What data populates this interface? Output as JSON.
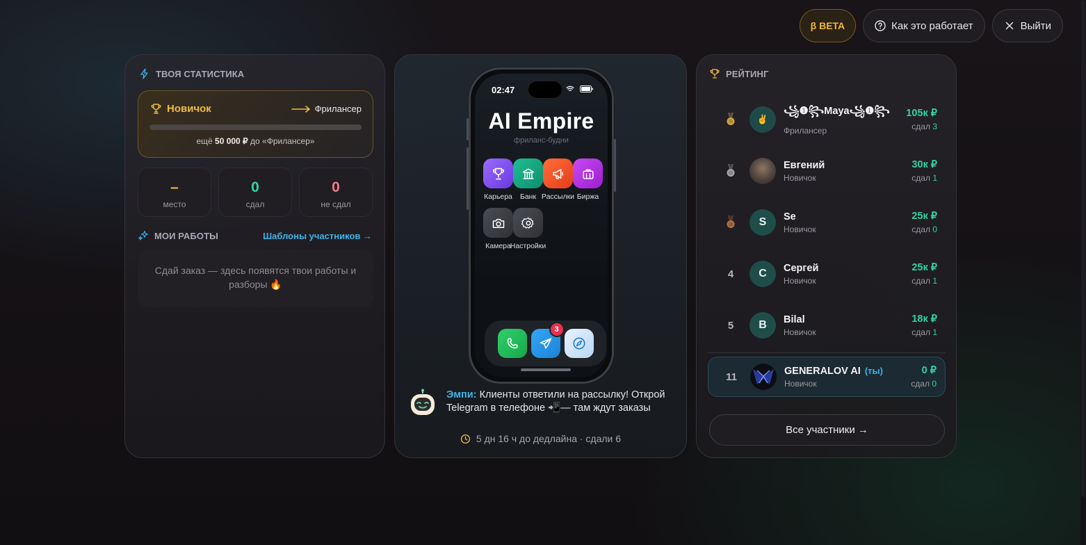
{
  "topbar": {
    "beta": "β BETA",
    "how": "Как это работает",
    "exit": "Выйти"
  },
  "stats_card": {
    "title": "ТВОЯ СТАТИСТИКА",
    "level_current": "Новичок",
    "level_next": "Фрилансер",
    "progress": 0.0,
    "hint_pre": "ещё",
    "hint_amount": "50 000 ₽",
    "hint_post": "до «Фрилансер»",
    "stats": [
      {
        "value": "–",
        "label": "место",
        "color": "#f2bc45"
      },
      {
        "value": "0",
        "label": "сдал",
        "color": "#34d3a0"
      },
      {
        "value": "0",
        "label": "не сдал",
        "color": "#f07a86"
      }
    ],
    "works_title": "МОИ РАБОТЫ",
    "templates_link": "Шаблоны участников →",
    "empty_text": "Сдай заказ — здесь появятся твои работы и разборы 🔥"
  },
  "phone": {
    "time": "02:47",
    "title": "AI Empire",
    "subtitle": "фриланс-будни",
    "apps": [
      {
        "name": "Карьера",
        "icon": "trophy-icon",
        "color": "#7b4de8"
      },
      {
        "name": "Банк",
        "icon": "bank-icon",
        "color": "#14a37f"
      },
      {
        "name": "Рассылки",
        "icon": "megaphone-icon",
        "color": "#ef5424"
      },
      {
        "name": "Биржа",
        "icon": "briefcase-icon",
        "color": "#b52ee0"
      },
      {
        "name": "Камера",
        "icon": "camera-icon",
        "color": "#3c3e44"
      },
      {
        "name": "Настройки",
        "icon": "gear-icon",
        "color": "#3c3e44"
      }
    ],
    "dock_badge": "3"
  },
  "assistant": {
    "name": "Эмпи:",
    "message": "Клиенты ответили на рассылку! Открой Telegram в телефоне 📲— там ждут заказы",
    "deadline": "5 дн 16 ч до дедлайна · сдали 6"
  },
  "rating": {
    "title": "РЕЙТИНГ",
    "rows": [
      {
        "pos": "",
        "medal": "gold",
        "avatar": "✌",
        "avatar_color": "#1f4a4a",
        "name": "꧁❶꧂Maya꧁❶꧂",
        "tier": "Фрилансер",
        "sum": "105к ₽",
        "done_label": "сдал",
        "done": "3"
      },
      {
        "pos": "",
        "medal": "silver",
        "avatar": "",
        "avatar_color": "#6b5a4e",
        "name": "Евгений",
        "tier": "Новичок",
        "sum": "30к ₽",
        "done_label": "сдал",
        "done": "1"
      },
      {
        "pos": "",
        "medal": "bronze",
        "avatar": "S",
        "avatar_color": "#1f4d4a",
        "name": "Se",
        "tier": "Новичок",
        "sum": "25к ₽",
        "done_label": "сдал",
        "done": "0"
      },
      {
        "pos": "4",
        "medal": "",
        "avatar": "С",
        "avatar_color": "#1f4d4a",
        "name": "Сергей",
        "tier": "Новичок",
        "sum": "25к ₽",
        "done_label": "сдал",
        "done": "1"
      },
      {
        "pos": "5",
        "medal": "",
        "avatar": "B",
        "avatar_color": "#1f4d4a",
        "name": "Bilal",
        "tier": "Новичок",
        "sum": "18к ₽",
        "done_label": "сдал",
        "done": "1"
      }
    ],
    "me": {
      "pos": "11",
      "name": "GENERALOV AI",
      "you": "(ты)",
      "tier": "Новичок",
      "sum": "0 ₽",
      "done_label": "сдал",
      "done": "0"
    },
    "all_button": "Все участники →"
  }
}
